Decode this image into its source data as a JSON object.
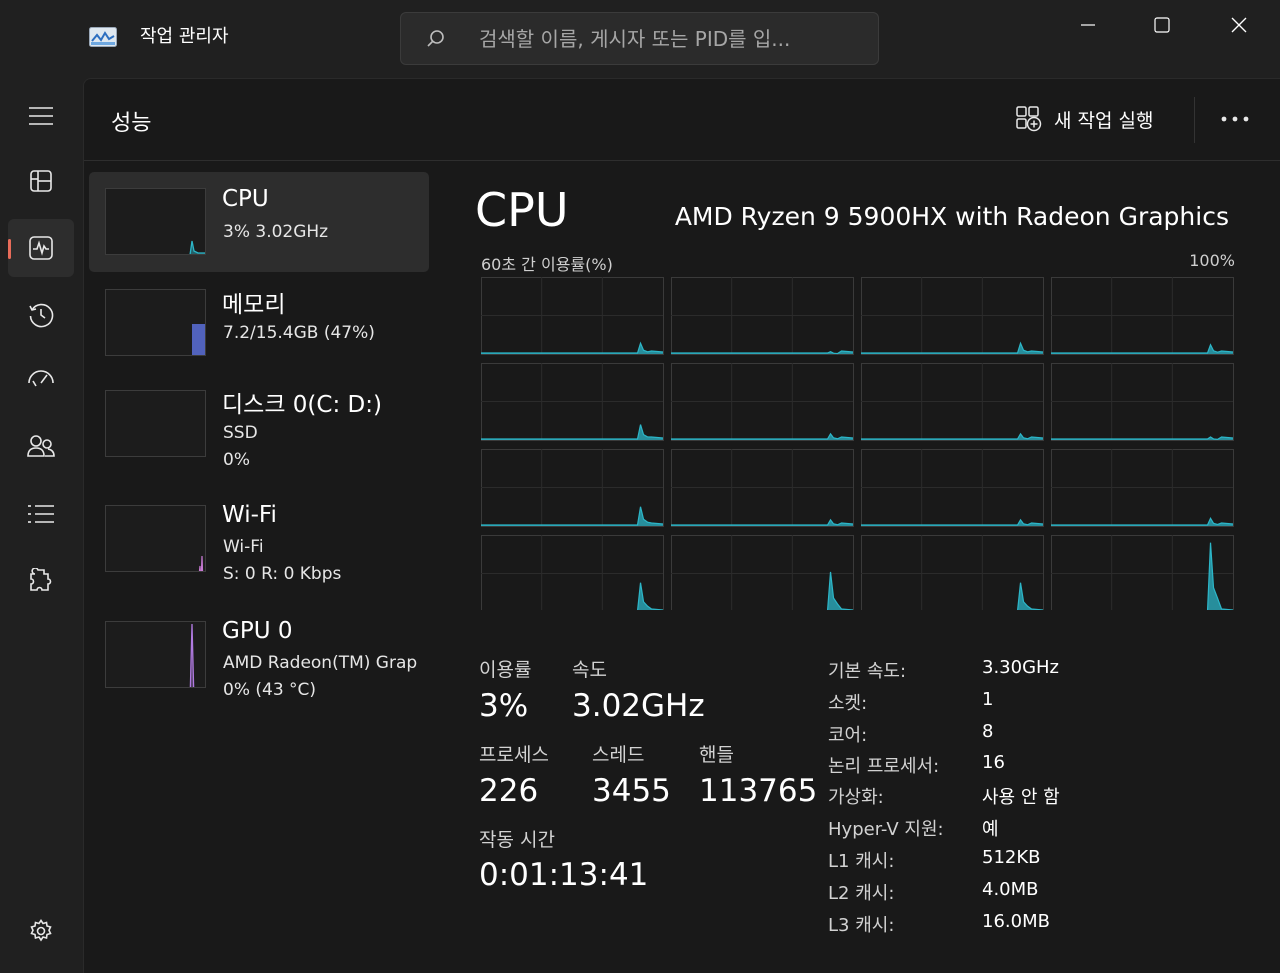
{
  "app": {
    "title": "작업 관리자",
    "search_placeholder": "검색할 이름, 게시자 또는 PID를 입..."
  },
  "colors": {
    "accent": "#e86c5a",
    "cpu_graph": "#2cb6c8",
    "memory_graph": "#5a6fd8",
    "network_graph": "#c87ad4",
    "gpu_graph": "#b07ae0"
  },
  "nav": [
    {
      "icon": "hamburger-icon"
    },
    {
      "icon": "processes-icon"
    },
    {
      "icon": "performance-icon",
      "active": true
    },
    {
      "icon": "app-history-icon"
    },
    {
      "icon": "startup-apps-icon"
    },
    {
      "icon": "users-icon"
    },
    {
      "icon": "details-icon"
    },
    {
      "icon": "services-icon"
    },
    {
      "icon": "settings-icon"
    }
  ],
  "header": {
    "title": "성능",
    "run_task": "새 작업 실행"
  },
  "devices": [
    {
      "name": "CPU",
      "line1": "3%  3.02GHz",
      "line2": "",
      "util": 0.03
    },
    {
      "name": "메모리",
      "line1": "7.2/15.4GB (47%)",
      "line2": "",
      "util": 0.47
    },
    {
      "name": "디스크 0(C: D:)",
      "line1": "SSD",
      "line2": "0%",
      "util": 0.0
    },
    {
      "name": "Wi-Fi",
      "line1": "Wi-Fi",
      "line2": "S: 0  R: 0 Kbps",
      "util": 0.0
    },
    {
      "name": "GPU 0",
      "line1": "AMD Radeon(TM) Grap",
      "line2": "0%  (43 °C)",
      "util": 0.0
    }
  ],
  "detail": {
    "title": "CPU",
    "model": "AMD Ryzen 9 5900HX with Radeon Graphics",
    "util_label": "60초 간 이용률(%)",
    "util_max": "100%",
    "stats": {
      "utilization_label": "이용률",
      "utilization": "3%",
      "speed_label": "속도",
      "speed": "3.02GHz",
      "processes_label": "프로세스",
      "processes": "226",
      "threads_label": "스레드",
      "threads": "3455",
      "handles_label": "핸들",
      "handles": "113765",
      "uptime_label": "작동 시간",
      "uptime": "0:01:13:41"
    },
    "info": [
      {
        "label": "기본 속도:",
        "value": "3.30GHz"
      },
      {
        "label": "소켓:",
        "value": "1"
      },
      {
        "label": "코어:",
        "value": "8"
      },
      {
        "label": "논리 프로세서:",
        "value": "16"
      },
      {
        "label": "가상화:",
        "value": "사용 안 함"
      },
      {
        "label": "Hyper-V 지원:",
        "value": "예"
      },
      {
        "label": "L1 캐시:",
        "value": "512KB"
      },
      {
        "label": "L2 캐시:",
        "value": "4.0MB"
      },
      {
        "label": "L3 캐시:",
        "value": "16.0MB"
      }
    ]
  }
}
